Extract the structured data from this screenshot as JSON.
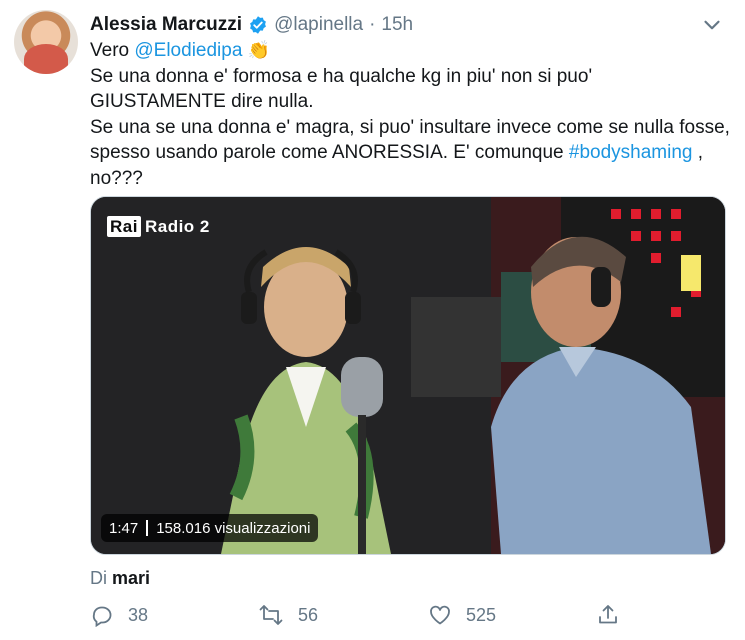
{
  "tweet": {
    "author_name": "Alessia Marcuzzi",
    "handle": "@lapinella",
    "separator": "·",
    "time": "15h",
    "text_vero": "Vero",
    "mention": "@Elodiedipa",
    "line2": "Se una donna e' formosa e ha qualche kg in piu' non si puo' GIUSTAMENTE dire nulla.",
    "line3_start": "Se una se una donna e' magra, si puo' insultare invece come se nulla fosse, spesso usando parole come ANORESSIA. E' comunque ",
    "hashtag": "#bodyshaming",
    "line3_end": " , no???"
  },
  "media": {
    "broadcaster": "Radio 2",
    "broadcaster_logo": "Rai",
    "duration": "1:47",
    "views": "158.016 visualizzazioni"
  },
  "via": {
    "label": "Di",
    "source": "mari"
  },
  "actions": {
    "replies": "38",
    "retweets": "56",
    "likes": "525"
  },
  "colors": {
    "link": "#1b95e0",
    "verified": "#1da1f2",
    "muted": "#657786"
  }
}
